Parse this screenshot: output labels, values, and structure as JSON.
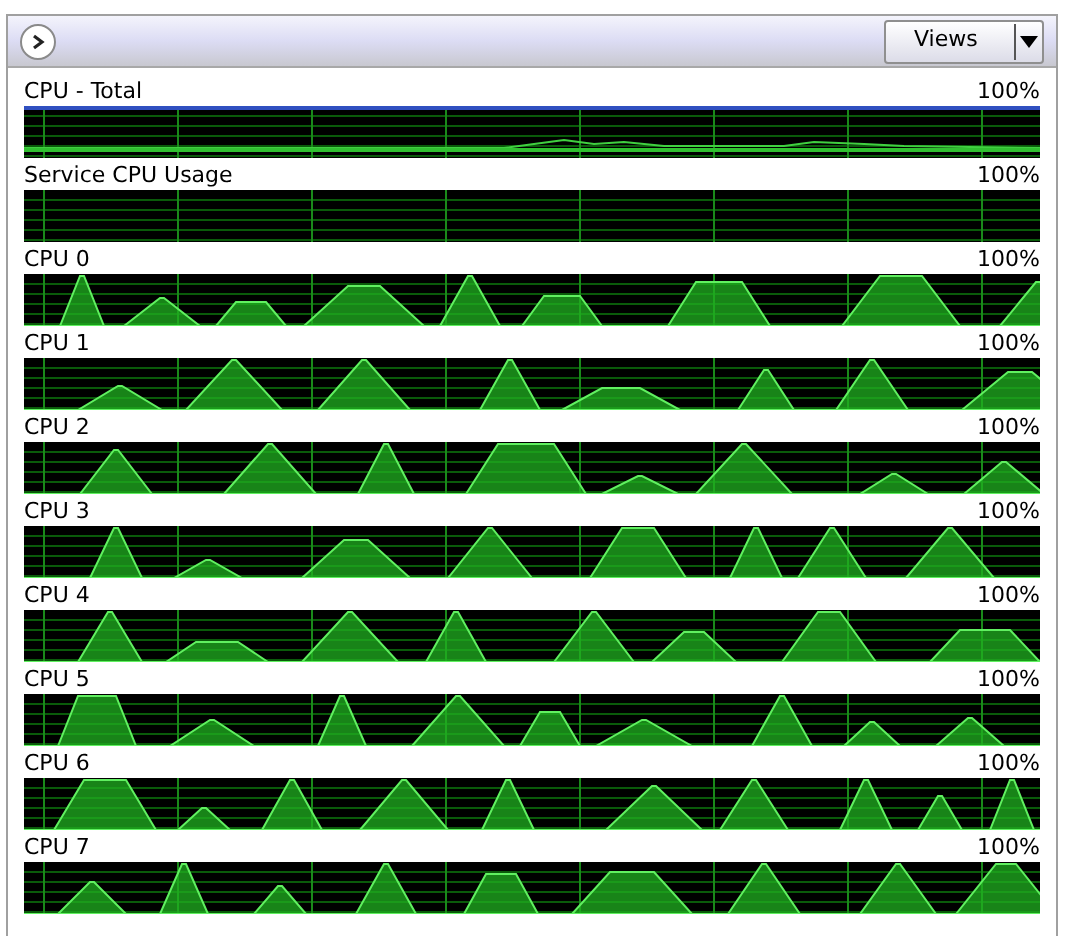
{
  "toolbar": {
    "views_button": "Views"
  },
  "graphs": [
    {
      "label": "CPU - Total",
      "reading": "100%"
    },
    {
      "label": "Service CPU Usage",
      "reading": "100%"
    },
    {
      "label": "CPU 0",
      "reading": "100%"
    },
    {
      "label": "CPU 1",
      "reading": "100%"
    },
    {
      "label": "CPU 2",
      "reading": "100%"
    },
    {
      "label": "CPU 3",
      "reading": "100%"
    },
    {
      "label": "CPU 4",
      "reading": "100%"
    },
    {
      "label": "CPU 5",
      "reading": "100%"
    },
    {
      "label": "CPU 6",
      "reading": "100%"
    },
    {
      "label": "CPU 7",
      "reading": "100%"
    }
  ]
}
